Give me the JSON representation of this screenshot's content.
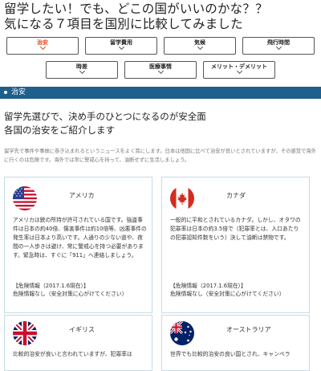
{
  "title": {
    "line1": "留学したい！でも、どこの国がいいのかな？？",
    "line2": "気になる７項目を国別に比較してみました"
  },
  "tabs": [
    {
      "label": "治安",
      "active": true
    },
    {
      "label": "留学費用"
    },
    {
      "label": "気候"
    },
    {
      "label": "飛行時間"
    },
    {
      "label": "時差"
    },
    {
      "label": "医療事情"
    },
    {
      "label": "メリット・デメリット"
    }
  ],
  "section": {
    "title": "治安"
  },
  "lead": {
    "line1": "留学先選びで、決め手のひとつになるのが安全面",
    "line2": "各国の治安をご紹介します"
  },
  "intro": "留学先で事件や事故に巻き込まれるというニュースをよく耳にします。日本は他国に比べて治安が良いとされていますが、その感覚で海外に行くのは危険です。海外では常に警戒心を持って、油断せずに生活しましょう。",
  "countries": [
    {
      "name": "アメリカ",
      "text": "アメリカは銃の所持が許可されている国です。強盗事件は日本の約40倍、傷害事件は約10倍等、凶悪事件の発生率は日本より高いです。人通りの少ない道や、夜間の一人歩きは避け、常に警戒心を持つ必要があります。緊急時は、すぐに「911」へ連絡しましょう。",
      "footer1": "【危険情報（2017.1.6現在）】",
      "footer2": "危険情報なし（安全対策に心がけてください）"
    },
    {
      "name": "カナダ",
      "text": "一般的に平和とされているカナダ。しかし、オタワの犯罪率は日本の約3.5倍で（犯罪率とは、人口あたりの犯罪認知件数をいう）決して油断は禁物です。",
      "footer1": "【危険情報（2017.1.6現在）】",
      "footer2": "危険情報なし（安全対策に心がけてください）"
    },
    {
      "name": "イギリス",
      "text": "比較的治安が良いと言われていますが、犯罪率は"
    },
    {
      "name": "オーストラリア",
      "text": "世界でも比較的治安の良い国とされ、キャンベラ"
    }
  ]
}
